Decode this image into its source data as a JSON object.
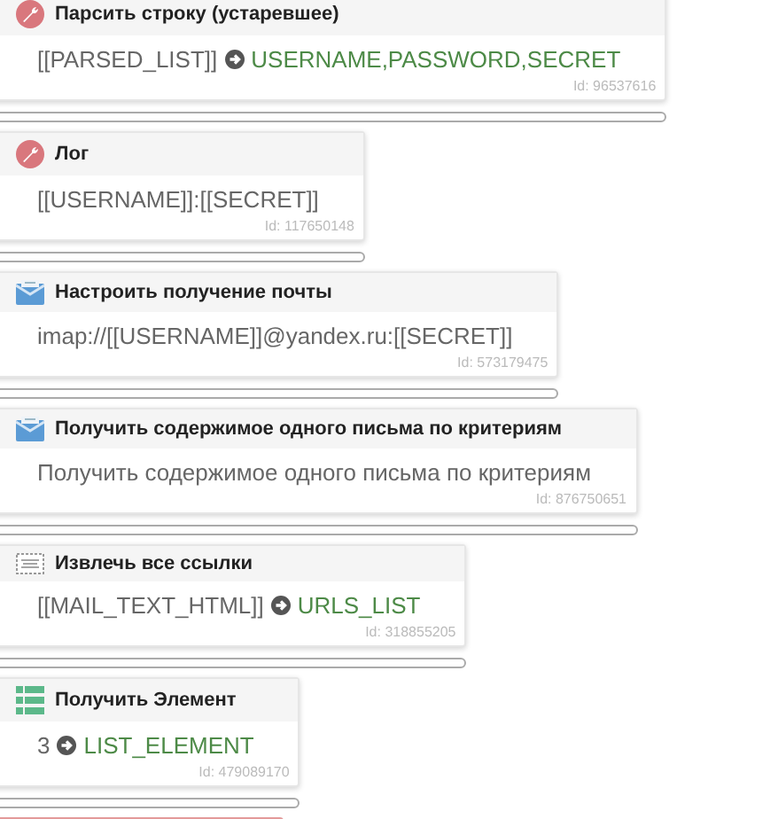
{
  "blocks": [
    {
      "kind": "wrench",
      "title": "Парсить строку (устаревшее)",
      "body": {
        "kind": "mapping",
        "input": "[[PARSED_LIST]]",
        "output": "USERNAME,PASSWORD,SECRET"
      },
      "id": "Id: 96537616"
    },
    {
      "kind": "wrench",
      "title": "Лог",
      "body": {
        "kind": "text",
        "text": "[[USERNAME]]:[[SECRET]]"
      },
      "id": "Id: 117650148"
    },
    {
      "kind": "mail",
      "title": "Настроить получение почты",
      "body": {
        "kind": "text",
        "text": "imap://[[USERNAME]]@yandex.ru:[[SECRET]]"
      },
      "id": "Id: 573179475"
    },
    {
      "kind": "mail",
      "title": "Получить содержимое одного письма по критериям",
      "body": {
        "kind": "text",
        "text": "Получить содержимое одного письма по критериям"
      },
      "id": "Id: 876750651"
    },
    {
      "kind": "txt",
      "title": "Извлечь все ссылки",
      "body": {
        "kind": "mapping",
        "input": "[[MAIL_TEXT_HTML]]",
        "output": "URLS_LIST"
      },
      "id": "Id: 318855205"
    },
    {
      "kind": "list",
      "title": "Получить Элемент",
      "body": {
        "kind": "mapping",
        "input": "3",
        "output": "LIST_ELEMENT"
      },
      "id": "Id: 479089170"
    }
  ],
  "next_block": {
    "highlighted": true
  }
}
